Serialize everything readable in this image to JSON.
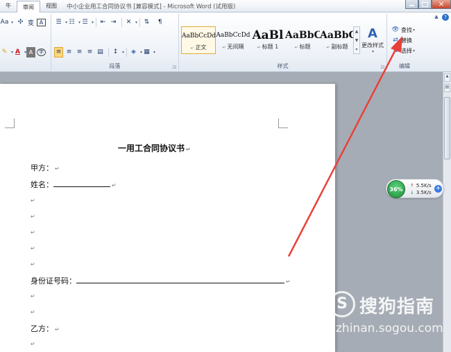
{
  "window": {
    "title": "中小企业用工合同协议书 [兼容模式] - Microsoft Word (试用版)",
    "tabs": [
      {
        "label": "牛"
      },
      {
        "label": "审阅"
      },
      {
        "label": "视图"
      }
    ]
  },
  "ribbon": {
    "groups": {
      "paragraph": "段落",
      "styles": "样式",
      "editing": "编辑"
    },
    "font_row1": [
      "Aa",
      "A",
      "变",
      "A"
    ],
    "style_gallery": [
      {
        "sample": "AaBbCcDd",
        "name": "正文",
        "active": true,
        "size": "9px"
      },
      {
        "sample": "AaBbCcDd",
        "name": "无间隔",
        "active": false,
        "size": "9px"
      },
      {
        "sample": "AaBl",
        "name": "标题 1",
        "active": false,
        "size": "17px"
      },
      {
        "sample": "AaBbC",
        "name": "标题",
        "active": false,
        "size": "14px"
      },
      {
        "sample": "AaBbC",
        "name": "副标题",
        "active": false,
        "size": "14px"
      }
    ],
    "change_styles": "更改样式",
    "editing": {
      "find": "查找",
      "replace": "替换",
      "select": "选择"
    }
  },
  "document": {
    "title": "一用工合同协议书",
    "party_a": "甲方：",
    "name_label": "姓名：",
    "id_label": "身份证号码：",
    "party_b": "乙方：",
    "paragraph_mark": "↵"
  },
  "net_widget": {
    "percent": "36%",
    "up_speed": "5.5K/s",
    "down_speed": "3.5K/s",
    "plus": "+"
  },
  "watermark": {
    "brand": "搜狗指南",
    "url": "zhinan.sogou.com",
    "logo": "S"
  },
  "colors": {
    "annotation_arrow": "#e8413a",
    "selected_button": "#fcd77a"
  }
}
